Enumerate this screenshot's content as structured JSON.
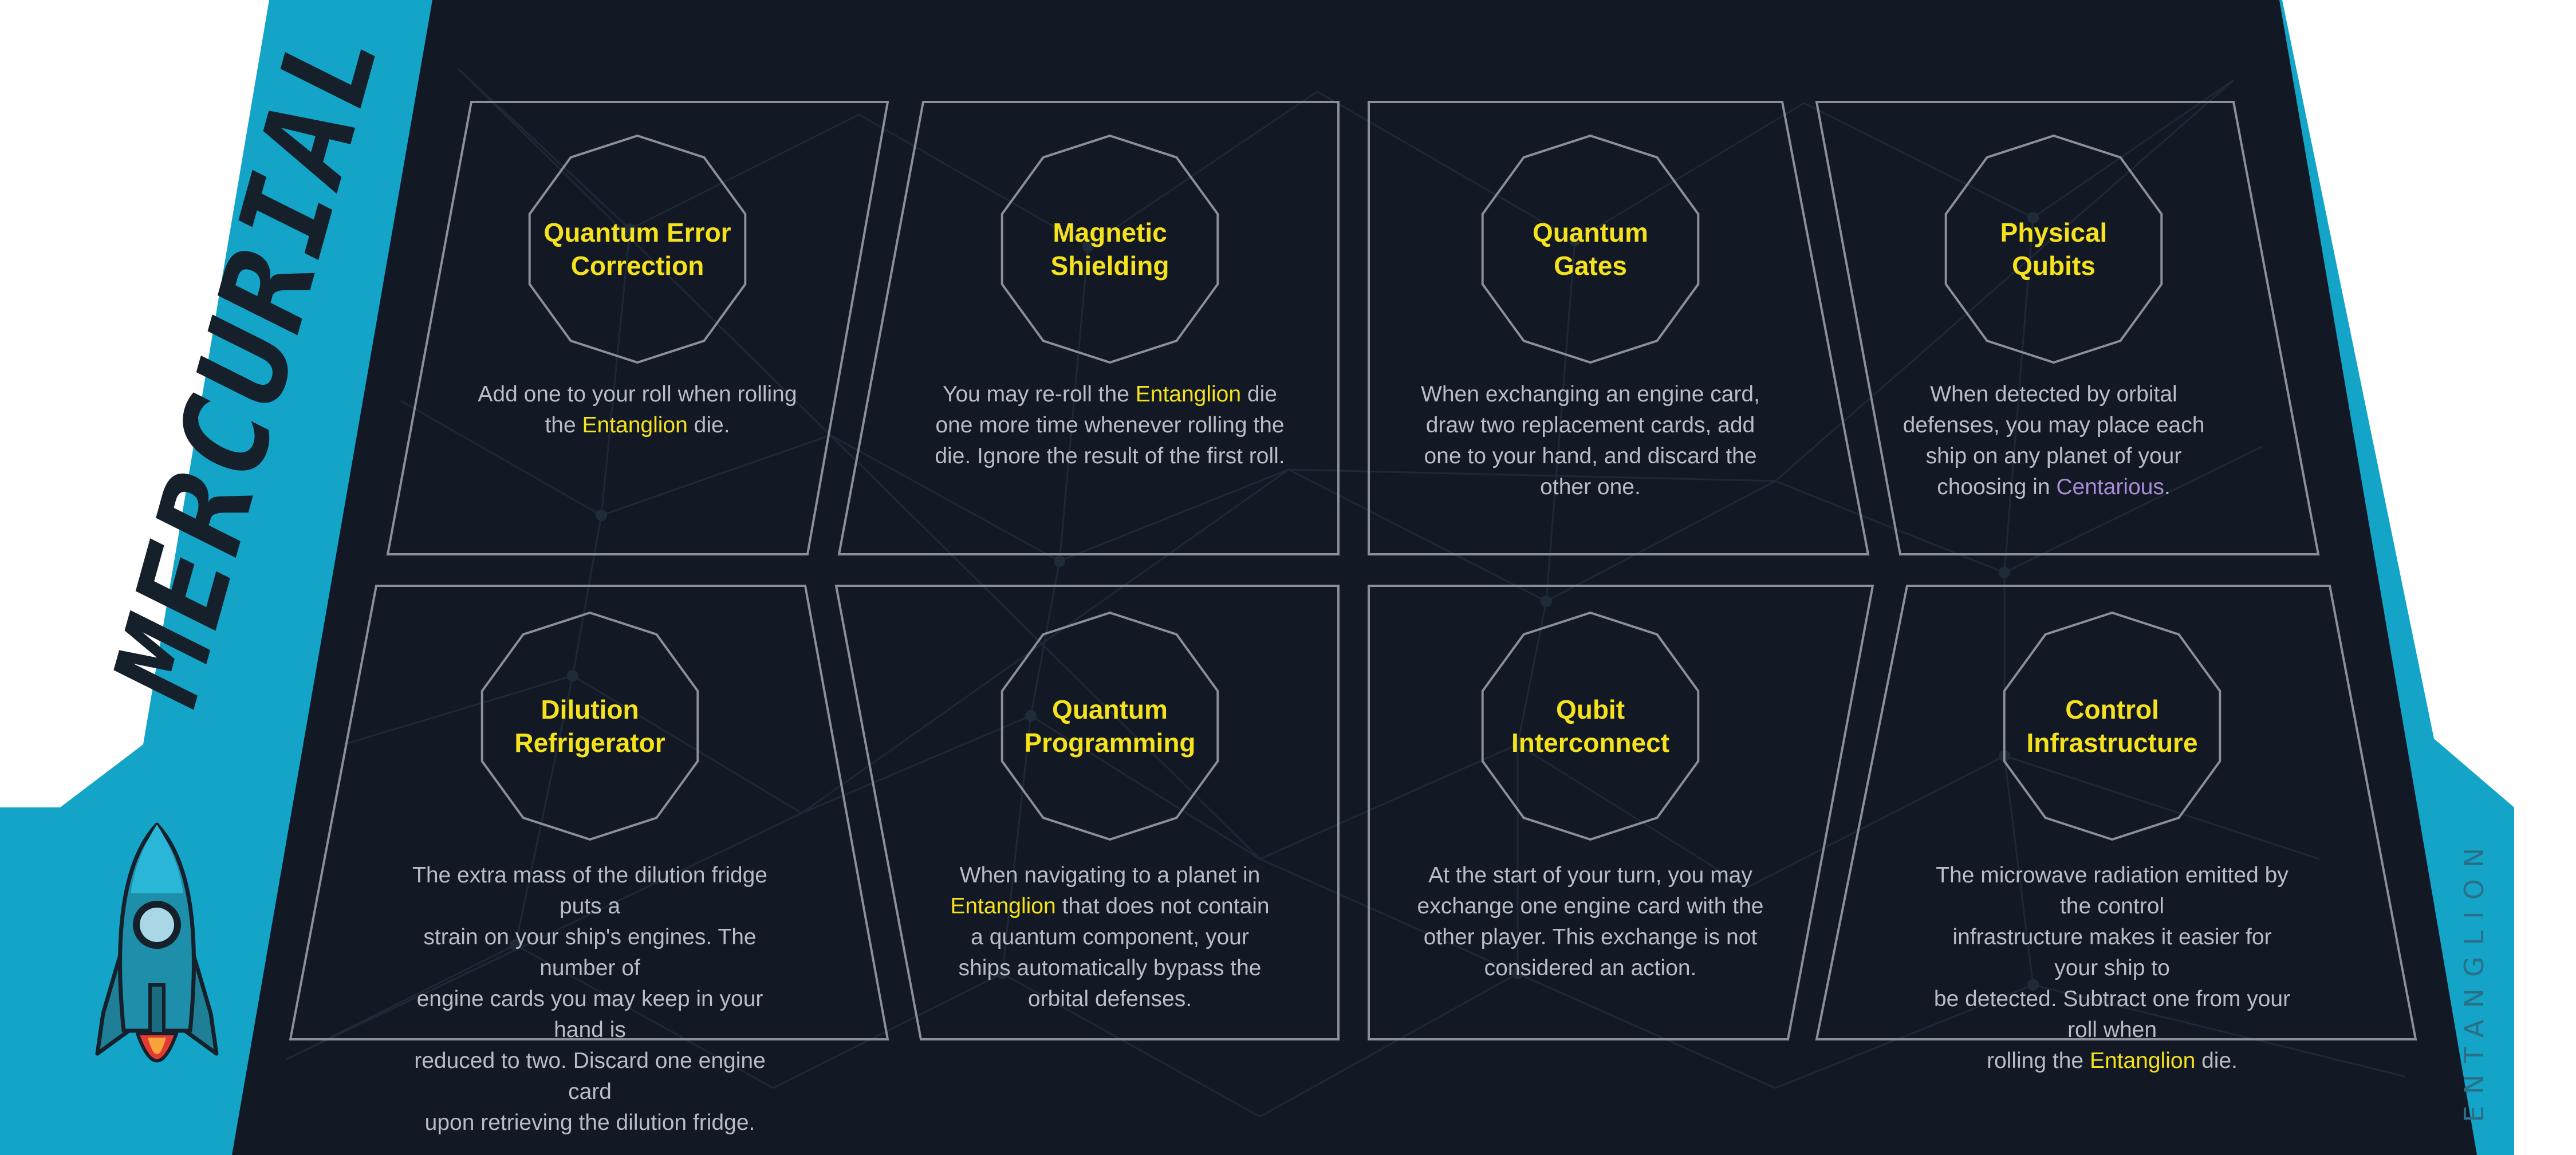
{
  "faction": {
    "name": "MERCURIAL",
    "color": "#13a4c7",
    "icon": "rocket-icon"
  },
  "game": {
    "brand": "ENTANGLION"
  },
  "colors": {
    "board": "#121924",
    "card_outline": "#8a8f98",
    "title": "#f5e21c",
    "body_text": "#b8bcc4",
    "keyword": "#f5e21c",
    "location": "#a98bd6"
  },
  "cards": [
    {
      "title_1": "Quantum Error",
      "title_2": "Correction",
      "desc": [
        {
          "parts": [
            {
              "t": "Add one to your roll when rolling"
            }
          ]
        },
        {
          "parts": [
            {
              "t": "the "
            },
            {
              "t": "Entanglion",
              "s": "yellow"
            },
            {
              "t": " die."
            }
          ]
        }
      ]
    },
    {
      "title_1": "Magnetic",
      "title_2": "Shielding",
      "desc": [
        {
          "parts": [
            {
              "t": "You may re-roll the "
            },
            {
              "t": "Entanglion",
              "s": "yellow"
            },
            {
              "t": " die"
            }
          ]
        },
        {
          "parts": [
            {
              "t": "one more time whenever rolling the"
            }
          ]
        },
        {
          "parts": [
            {
              "t": "die. Ignore the result of the first roll."
            }
          ]
        }
      ]
    },
    {
      "title_1": "Quantum",
      "title_2": "Gates",
      "desc": [
        {
          "parts": [
            {
              "t": "When exchanging an engine card,"
            }
          ]
        },
        {
          "parts": [
            {
              "t": "draw two replacement cards, add"
            }
          ]
        },
        {
          "parts": [
            {
              "t": "one to your hand, and discard the"
            }
          ]
        },
        {
          "parts": [
            {
              "t": "other one."
            }
          ]
        }
      ]
    },
    {
      "title_1": "Physical",
      "title_2": "Qubits",
      "desc": [
        {
          "parts": [
            {
              "t": "When detected by orbital"
            }
          ]
        },
        {
          "parts": [
            {
              "t": "defenses, you may place each"
            }
          ]
        },
        {
          "parts": [
            {
              "t": "ship on any planet of your"
            }
          ]
        },
        {
          "parts": [
            {
              "t": "choosing in "
            },
            {
              "t": "Centarious",
              "s": "purple"
            },
            {
              "t": "."
            }
          ]
        }
      ]
    },
    {
      "title_1": "Dilution",
      "title_2": "Refrigerator",
      "desc": [
        {
          "parts": [
            {
              "t": "The extra mass of the dilution fridge puts a"
            }
          ]
        },
        {
          "parts": [
            {
              "t": "strain on your ship's engines. The number of"
            }
          ]
        },
        {
          "parts": [
            {
              "t": "engine cards you may keep in your hand is"
            }
          ]
        },
        {
          "parts": [
            {
              "t": "reduced to two. Discard one engine card"
            }
          ]
        },
        {
          "parts": [
            {
              "t": "upon retrieving the dilution fridge."
            }
          ]
        }
      ]
    },
    {
      "title_1": "Quantum",
      "title_2": "Programming",
      "desc": [
        {
          "parts": [
            {
              "t": "When navigating to a planet in"
            }
          ]
        },
        {
          "parts": [
            {
              "t": "Entanglion",
              "s": "yellow"
            },
            {
              "t": " that does not contain"
            }
          ]
        },
        {
          "parts": [
            {
              "t": "a quantum component, your"
            }
          ]
        },
        {
          "parts": [
            {
              "t": "ships automatically bypass the"
            }
          ]
        },
        {
          "parts": [
            {
              "t": "orbital defenses."
            }
          ]
        }
      ]
    },
    {
      "title_1": "Qubit",
      "title_2": "Interconnect",
      "desc": [
        {
          "parts": [
            {
              "t": "At the start of your turn, you may"
            }
          ]
        },
        {
          "parts": [
            {
              "t": "exchange one engine card with the"
            }
          ]
        },
        {
          "parts": [
            {
              "t": "other player. This exchange is not"
            }
          ]
        },
        {
          "parts": [
            {
              "t": "considered an action."
            }
          ]
        }
      ]
    },
    {
      "title_1": "Control",
      "title_2": "Infrastructure",
      "desc": [
        {
          "parts": [
            {
              "t": "The microwave radiation emitted by the control"
            }
          ]
        },
        {
          "parts": [
            {
              "t": "infrastructure makes it easier for your ship to"
            }
          ]
        },
        {
          "parts": [
            {
              "t": "be detected. Subtract one from your roll when"
            }
          ]
        },
        {
          "parts": [
            {
              "t": "rolling the "
            },
            {
              "t": "Entanglion",
              "s": "yellow"
            },
            {
              "t": " die."
            }
          ]
        }
      ]
    }
  ]
}
